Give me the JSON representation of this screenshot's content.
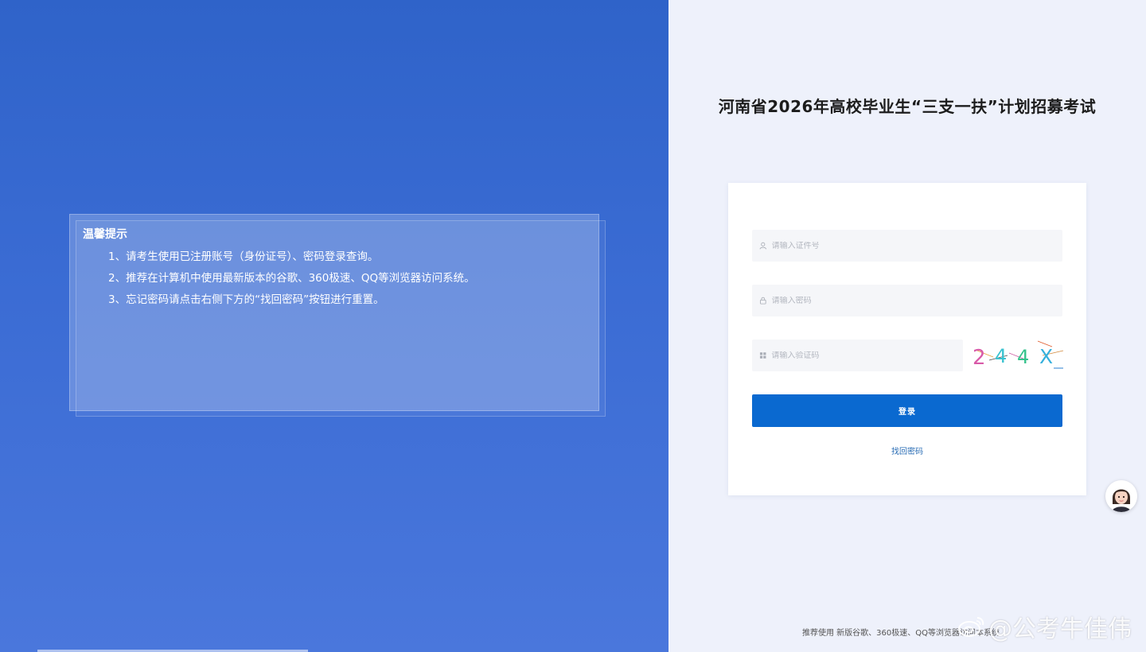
{
  "notice": {
    "title": "温馨提示",
    "items": [
      "1、请考生使用已注册账号（身份证号）、密码登录查询。",
      "2、推荐在计算机中使用最新版本的谷歌、360极速、QQ等浏览器访问系统。",
      "3、忘记密码请点击右侧下方的“找回密码”按钮进行重置。"
    ]
  },
  "page_title": "河南省2026年高校毕业生“三支一扶”计划招募考试",
  "login": {
    "id_placeholder": "请输入证件号",
    "password_placeholder": "请输入密码",
    "captcha_placeholder": "请输入验证码",
    "captcha_chars": [
      "2",
      "4",
      "4",
      "X"
    ],
    "login_label": "登录",
    "forgot_label": "找回密码"
  },
  "footer": {
    "note": "推荐使用 新版谷歌、360极速、QQ等浏览器访问本系统"
  },
  "watermark": {
    "text": "@公考牛佳伟"
  },
  "colors": {
    "primary": "#0a69d0",
    "left_bg": "#3b6cd4",
    "right_bg": "#eef1fb"
  }
}
